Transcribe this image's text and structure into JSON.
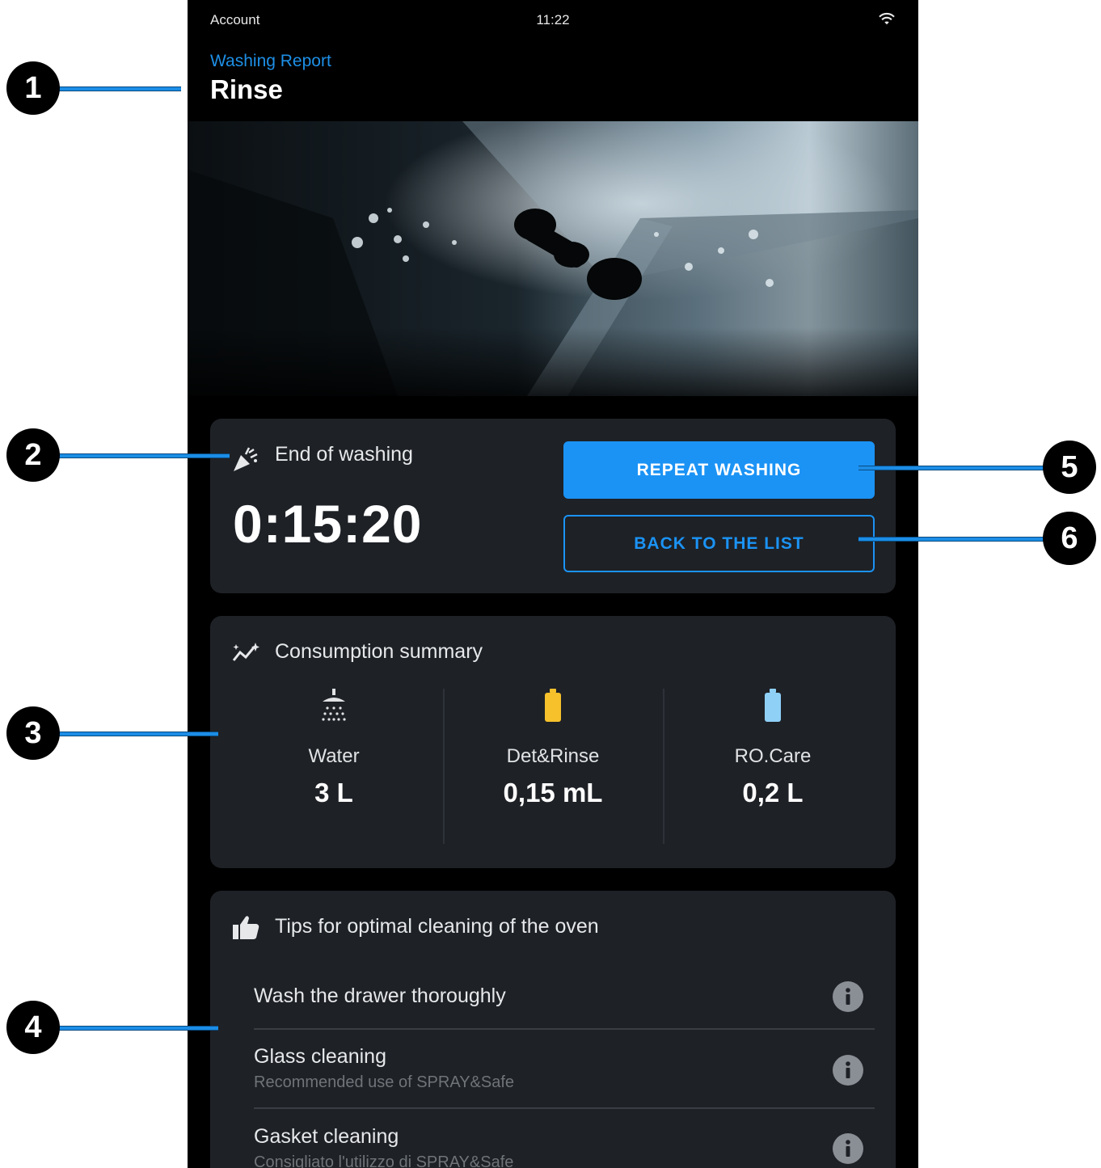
{
  "status_bar": {
    "left": "Account",
    "time": "11:22",
    "wifi_icon": "wifi-icon"
  },
  "header": {
    "breadcrumb": "Washing Report",
    "title": "Rinse"
  },
  "end_card": {
    "icon": "party-popper-icon",
    "title": "End of washing",
    "duration": "0:15:20",
    "primary_button": "REPEAT WASHING",
    "secondary_button": "BACK TO THE LIST"
  },
  "consumption": {
    "icon": "trend-sparkle-icon",
    "title": "Consumption summary",
    "items": [
      {
        "label": "Water",
        "value": "3 L",
        "icon": "shower-icon"
      },
      {
        "label": "Det&Rinse",
        "value": "0,15 mL",
        "icon": "battery-icon",
        "color": "#f6c12b"
      },
      {
        "label": "RO.Care",
        "value": "0,2 L",
        "icon": "battery-icon",
        "color": "#8fd0f7"
      }
    ]
  },
  "tips": {
    "icon": "thumbs-up-icon",
    "title": "Tips for optimal cleaning of the oven",
    "items": [
      {
        "title": "Wash the drawer thoroughly",
        "subtitle": ""
      },
      {
        "title": "Glass cleaning",
        "subtitle": "Recommended use of SPRAY&Safe"
      },
      {
        "title": "Gasket cleaning",
        "subtitle": "Consigliato l'utilizzo di SPRAY&Safe"
      }
    ]
  },
  "callouts": [
    "1",
    "2",
    "3",
    "4",
    "5",
    "6"
  ],
  "colors": {
    "accent": "#1b93f5",
    "card": "#1e2126",
    "background": "#000000"
  }
}
